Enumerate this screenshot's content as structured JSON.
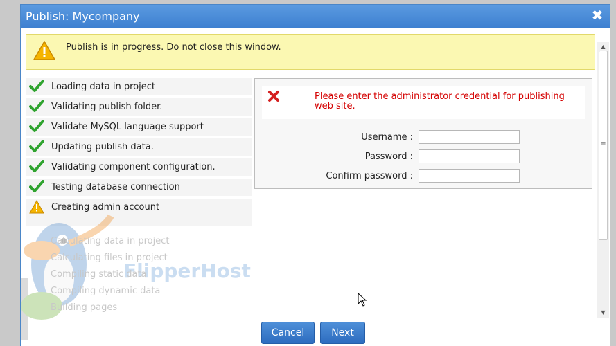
{
  "window": {
    "title": "Publish: Mycompany",
    "close_glyph": "✖"
  },
  "alert": {
    "icon": "warning-icon",
    "text": "Publish is in progress. Do not close this window."
  },
  "steps": [
    {
      "label": "Loading data in project",
      "status": "done",
      "icon": "check-icon"
    },
    {
      "label": "Validating publish folder.",
      "status": "done",
      "icon": "check-icon"
    },
    {
      "label": "Validate MySQL language support",
      "status": "done",
      "icon": "check-icon"
    },
    {
      "label": "Updating publish data.",
      "status": "done",
      "icon": "check-icon"
    },
    {
      "label": "Validating component configuration.",
      "status": "done",
      "icon": "check-icon"
    },
    {
      "label": "Testing database connection",
      "status": "done",
      "icon": "check-icon"
    },
    {
      "label": "Creating admin account",
      "status": "warning",
      "icon": "warning-icon"
    }
  ],
  "pending_steps": [
    "Calculating data in project",
    "Calculating files in project",
    "Compiling static data",
    "Compiling dynamic data",
    "Building pages"
  ],
  "watermark": {
    "brand": "FlipperHost"
  },
  "credentials": {
    "error_icon": "error-x-icon",
    "error_text": "Please enter the administrator credential for publishing web site.",
    "username_label": "Username :",
    "username_value": "",
    "password_label": "Password :",
    "password_value": "",
    "confirm_label": "Confirm password :",
    "confirm_value": ""
  },
  "buttons": {
    "cancel": "Cancel",
    "next": "Next"
  },
  "colors": {
    "title_bar": "#3d7fd0",
    "alert_bg": "#fbf8b2",
    "error_text": "#d40000",
    "check": "#2fa32f",
    "button": "#2d6cbf"
  }
}
